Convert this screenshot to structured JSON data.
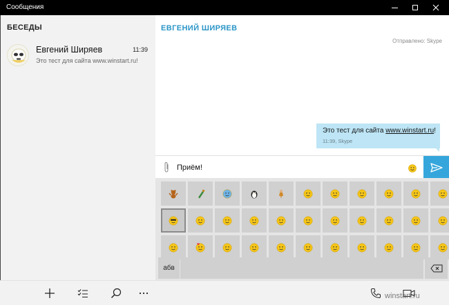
{
  "window": {
    "title": "Сообщения",
    "controls": [
      "minimize-icon",
      "maximize-icon",
      "close-icon"
    ]
  },
  "sidebar": {
    "heading": "БЕСЕДЫ",
    "conversations": [
      {
        "name": "Евгений Ширяев",
        "time": "11:39",
        "preview": "Это тест для сайта www.winstart.ru!",
        "avatar_icon": "stormtrooper-avatar-icon"
      }
    ]
  },
  "chat": {
    "contact_name": "ЕВГЕНИЙ ШИРЯЕВ",
    "sent_via": "Отправлено: Skype",
    "messages": [
      {
        "text_prefix": "Это тест для сайта ",
        "link": "www.winstart.ru",
        "text_suffix": "!",
        "meta": "11:39, Skype",
        "bubble_color": "#bde5f5"
      }
    ]
  },
  "composer": {
    "value": "Приём!",
    "attach_icon": "paperclip-icon",
    "emoji_icon": "smiley-icon",
    "send_icon": "send-icon",
    "send_color": "#35a6dc"
  },
  "emoji_panel": {
    "selected_index": 11,
    "emojis": [
      "dancing-bear",
      "bottle",
      "crying-face",
      "penguin",
      "man",
      "headphones-face",
      "monkey",
      "smiley",
      "sad",
      "big-grin",
      "laughing",
      "cool-sunglasses",
      "surprised",
      "wink",
      "crying",
      "thinking",
      "neutral",
      "angry",
      "tongue-out",
      "indifferent",
      "worried",
      "sleepy",
      "smirk",
      "in-love",
      "anxious",
      "yawn",
      "puking",
      "blush",
      "smug",
      "whistling",
      "party",
      "sweating",
      "grinning"
    ],
    "abc_label": "абв",
    "backspace_icon": "backspace-icon"
  },
  "bottom_bar": {
    "left_icons": [
      "add-icon",
      "select-icon",
      "search-icon",
      "more-icon"
    ],
    "right_icons": [
      "phone-icon",
      "video-icon"
    ],
    "watermark": "winstart.ru"
  },
  "colors": {
    "accent": "#2b96c8",
    "titlebar": "#000000",
    "sidebar": "#f2f2f2"
  }
}
